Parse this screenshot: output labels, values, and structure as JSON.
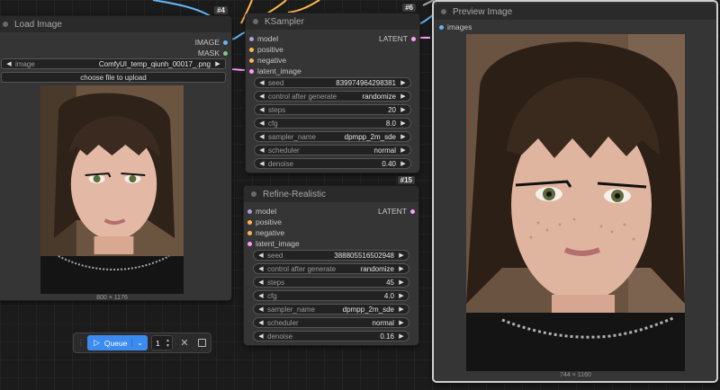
{
  "load_image": {
    "title": "Load Image",
    "id": "#4",
    "outputs": [
      "IMAGE",
      "MASK"
    ],
    "image_widget": {
      "label": "image",
      "value": "ComfyUI_temp_qiunh_00017_.png"
    },
    "upload_button": "choose file to upload",
    "size": "800 × 1176"
  },
  "ksampler": {
    "title": "KSampler",
    "id": "#6",
    "inputs": [
      "model",
      "positive",
      "negative",
      "latent_image"
    ],
    "output": "LATENT",
    "widgets": [
      {
        "label": "seed",
        "value": "839974964298381"
      },
      {
        "label": "control after generate",
        "value": "randomize"
      },
      {
        "label": "steps",
        "value": "20"
      },
      {
        "label": "cfg",
        "value": "8.0"
      },
      {
        "label": "sampler_name",
        "value": "dpmpp_2m_sde"
      },
      {
        "label": "scheduler",
        "value": "normal"
      },
      {
        "label": "denoise",
        "value": "0.40"
      }
    ]
  },
  "refine": {
    "title": "Refine-Realistic",
    "id": "#15",
    "inputs": [
      "model",
      "positive",
      "negative",
      "latent_image"
    ],
    "output": "LATENT",
    "widgets": [
      {
        "label": "seed",
        "value": "388805516502948"
      },
      {
        "label": "control after generate",
        "value": "randomize"
      },
      {
        "label": "steps",
        "value": "45"
      },
      {
        "label": "cfg",
        "value": "4.0"
      },
      {
        "label": "sampler_name",
        "value": "dpmpp_2m_sde"
      },
      {
        "label": "scheduler",
        "value": "normal"
      },
      {
        "label": "denoise",
        "value": "0.16"
      }
    ]
  },
  "preview": {
    "title": "Preview Image",
    "input": "images",
    "size": "744 × 1160"
  },
  "queue": {
    "label": "Queue",
    "count": "1",
    "play_icon": "play-icon",
    "clear_icon": "close-icon",
    "stop_icon": "square-icon"
  },
  "colors": {
    "queue_button": "#3c8bf0",
    "latent_wire": "#ff9cf9",
    "image_wire": "#64b5f6",
    "conditioning_wire": "#ffb74d"
  }
}
